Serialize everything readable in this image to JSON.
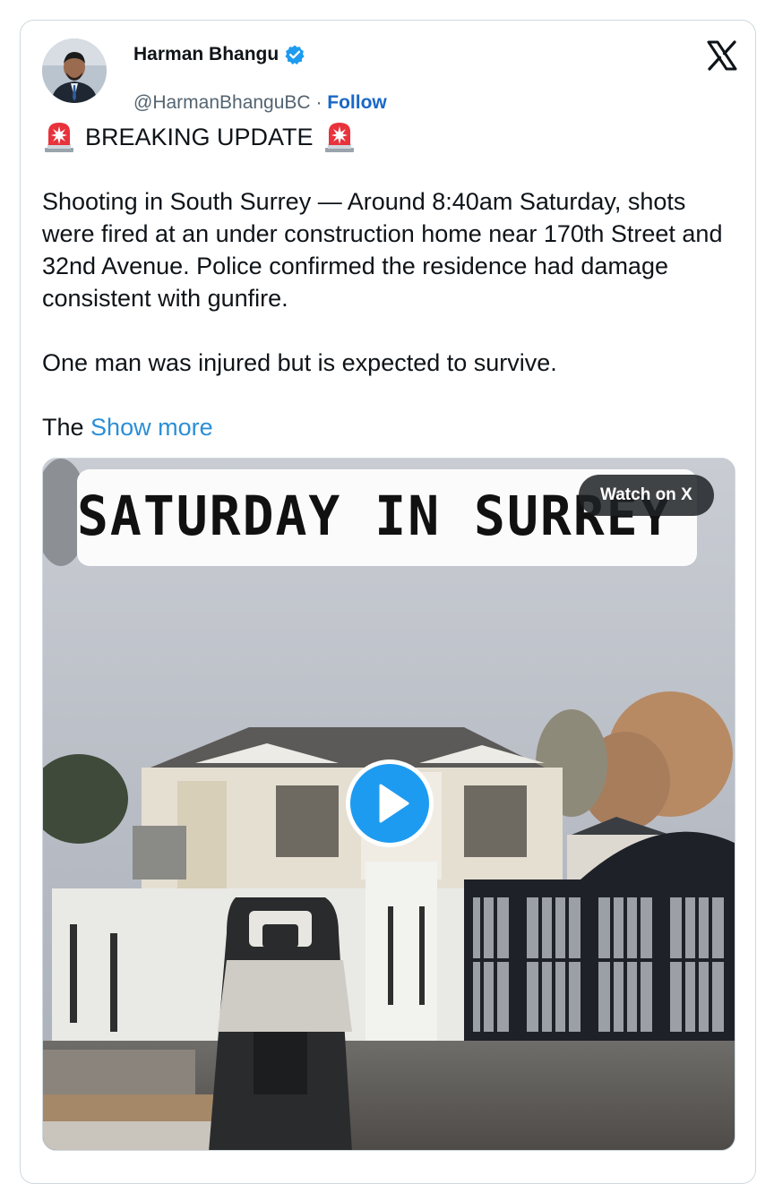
{
  "author": {
    "display_name": "Harman Bhangu",
    "handle": "@HarmanBhanguBC",
    "separator": "·",
    "follow_label": "Follow"
  },
  "icons": {
    "verified": "verified-badge-icon",
    "platform": "x-logo-icon",
    "siren": "police-light-emoji",
    "play": "play-icon"
  },
  "tweet": {
    "headline": "BREAKING UPDATE",
    "paragraph_1": "Shooting in South Surrey — Around 8:40am Saturday, shots were fired at an under construction home near 170th Street and 32nd Avenue. Police confirmed the residence had damage consistent with gunfire.",
    "paragraph_2": "One man was injured but is expected to survive.",
    "truncated_lead": "The",
    "show_more_label": "Show more"
  },
  "media": {
    "overlay_caption": "SATURDAY IN SURREY BC",
    "watch_button_label": "Watch on X"
  },
  "colors": {
    "link_blue": "#1d9bf0",
    "text_primary": "#0f1419",
    "text_secondary": "#536471",
    "border": "#cfd9de"
  }
}
